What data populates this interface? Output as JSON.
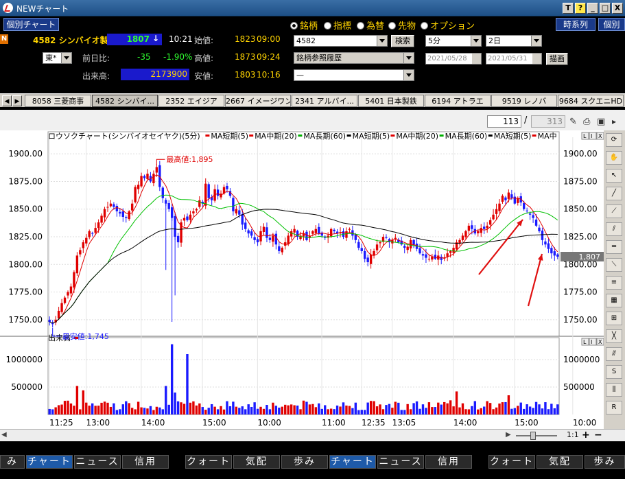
{
  "window": {
    "title": "NEWチャート",
    "buttons": [
      "T",
      "?",
      "_",
      "□",
      "X"
    ]
  },
  "header": {
    "mode_label": "個別チャート",
    "market_flag": "N",
    "code_name": "4582 シンバイオ製",
    "price": "1807",
    "arrow": "↓",
    "time": "10:21",
    "exchange": "東*",
    "labels": {
      "prev_change": "前日比:",
      "volume": "出来高:",
      "open": "始値:",
      "high": "高値:",
      "low": "安値:"
    },
    "change": "-35",
    "change_pct": "-1.90%",
    "volume": "2173900",
    "open": {
      "value": "1823",
      "time": "09:00"
    },
    "high": {
      "value": "1873",
      "time": "09:24"
    },
    "low": {
      "value": "1803",
      "time": "10:16"
    },
    "radios": [
      "銘柄",
      "指標",
      "為替",
      "先物",
      "オプション"
    ],
    "code_input": "4582",
    "search_btn": "検索",
    "history_select": "銘柄参照履歴",
    "blank_select": "—",
    "interval": "5分",
    "period": "2日",
    "date_from": "2021/05/28",
    "date_to": "2021/05/31",
    "draw_btn": "描画",
    "timeseries_btn": "時系列",
    "individual_btn": "個別"
  },
  "tabs": [
    "8058 三菱商事",
    "4582 シンバイ...",
    "2352 エイジア",
    "2667 イメージワン",
    "2341 アルバイ...",
    "5401 日本製鉄",
    "6194 アトラエ",
    "9519 レノバ",
    "9684 スクエニHD"
  ],
  "pager": {
    "current": "113",
    "total": "313"
  },
  "chart_data": {
    "type": "candlestick",
    "legend": [
      "ロウソクチャート(シンバイオセイヤク)(5分)",
      "MA短期(5)",
      "MA中期(20)",
      "MA長期(60)",
      "MA短期(5)",
      "MA中期(20)",
      "MA長期(60)",
      "MA短期(5)",
      "MA中"
    ],
    "legend_colors": [
      "#000000",
      "#e00000",
      "#e00000",
      "#00b000",
      "#000000",
      "#e00000",
      "#00b000",
      "#000000",
      "#e00000"
    ],
    "ylim": [
      1735,
      1915
    ],
    "y_ticks": [
      "1900.00",
      "1875.00",
      "1850.00",
      "1825.00",
      "1800.00",
      "1775.00",
      "1750.00"
    ],
    "y_tick_values": [
      1900,
      1875,
      1850,
      1825,
      1800,
      1775,
      1750
    ],
    "x_ticks": [
      "11:25",
      "13:00",
      "14:00",
      "15:00",
      "10:00",
      "11:00",
      "12:35",
      "13:05",
      "14:00",
      "15:00",
      "10:00"
    ],
    "x_tick_index": [
      0,
      12,
      30,
      50,
      68,
      89,
      102,
      112,
      132,
      152,
      171
    ],
    "current_price_label": "1,807",
    "current_price": 1807,
    "max_label": "最高値:1,895",
    "max_value": 1895,
    "min_label": "最安値:1,745",
    "min_value": 1745,
    "closes": [
      1748,
      1746,
      1750,
      1758,
      1765,
      1770,
      1775,
      1780,
      1793,
      1808,
      1813,
      1820,
      1824,
      1830,
      1828,
      1833,
      1838,
      1844,
      1850,
      1852,
      1855,
      1852,
      1848,
      1846,
      1843,
      1842,
      1848,
      1855,
      1870,
      1872,
      1880,
      1878,
      1882,
      1875,
      1882,
      1888,
      1870,
      1860,
      1855,
      1850,
      1842,
      1825,
      1820,
      1838,
      1842,
      1840,
      1845,
      1848,
      1850,
      1858,
      1855,
      1873,
      1860,
      1858,
      1868,
      1862,
      1864,
      1870,
      1868,
      1862,
      1848,
      1850,
      1845,
      1836,
      1832,
      1828,
      1826,
      1822,
      1820,
      1830,
      1834,
      1824,
      1822,
      1826,
      1818,
      1812,
      1815,
      1820,
      1826,
      1830,
      1832,
      1825,
      1826,
      1828,
      1822,
      1826,
      1830,
      1832,
      1828,
      1826,
      1824,
      1826,
      1832,
      1830,
      1828,
      1829,
      1825,
      1830,
      1832,
      1826,
      1822,
      1815,
      1812,
      1805,
      1802,
      1809,
      1812,
      1818,
      1820,
      1825,
      1824,
      1820,
      1822,
      1824,
      1820,
      1818,
      1815,
      1816,
      1822,
      1818,
      1814,
      1810,
      1808,
      1806,
      1805,
      1807,
      1805,
      1808,
      1804,
      1806,
      1810,
      1812,
      1815,
      1820,
      1822,
      1826,
      1830,
      1835,
      1832,
      1828,
      1830,
      1833,
      1832,
      1835,
      1840,
      1845,
      1850,
      1855,
      1862,
      1858,
      1865,
      1860,
      1855,
      1860,
      1856,
      1850,
      1848,
      1845,
      1842,
      1835,
      1830,
      1822,
      1818,
      1814,
      1810,
      1808,
      1807
    ],
    "volume_ylim": [
      0,
      1300000
    ],
    "volume_ticks": [
      "1000000",
      "500000"
    ],
    "volume_tick_values": [
      1000000,
      500000
    ],
    "volume_label": "出来高",
    "annotations": [
      "arrow-1",
      "arrow-2"
    ]
  },
  "bottom_tabs_left": [
    "み",
    "チャート",
    "ニュース",
    "信用"
  ],
  "bottom_tabs_mid": [
    "クォート",
    "気配",
    "歩み",
    "チャート",
    "ニュース",
    "信用"
  ],
  "bottom_tabs_right": [
    "クォート",
    "気配",
    "歩み"
  ],
  "colors": {
    "up": "#e00000",
    "down": "#1a1aff",
    "ma_short": "#e00000",
    "ma_mid": "#00c000",
    "ma_long": "#000000",
    "accent": "#1a3a8a"
  }
}
